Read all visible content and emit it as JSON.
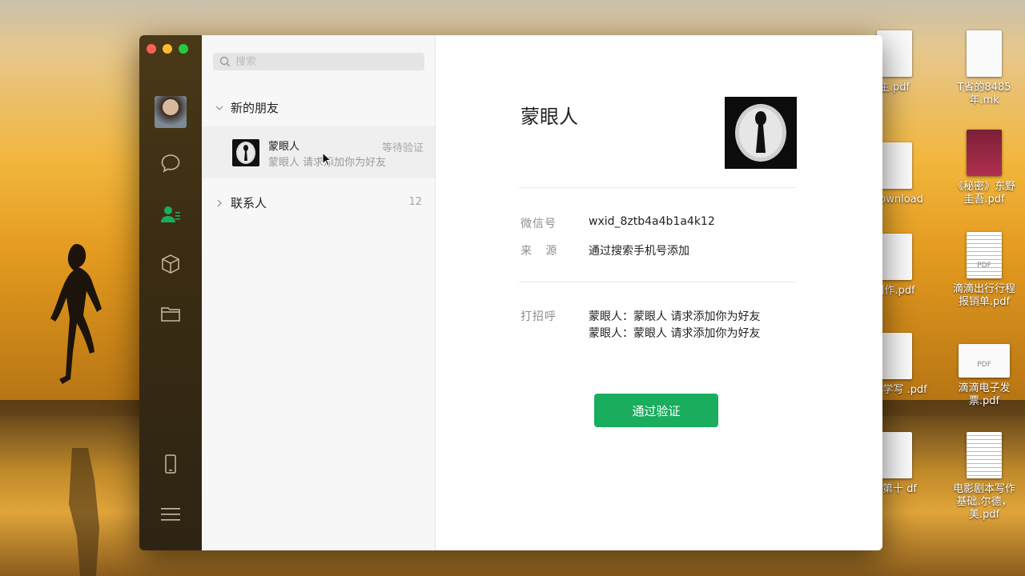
{
  "desktop": {
    "icons": [
      {
        "label": "主.pdf"
      },
      {
        "label": "T省的8485年.mk"
      },
      {
        "label": "人 ownload"
      },
      {
        "label": "《秘密》东野圭吾.pdf"
      },
      {
        "label": "创作.pdf"
      },
      {
        "label": "滴滴出行行程报销单.pdf"
      },
      {
        "label": "构文学写 .pdf"
      },
      {
        "label": "滴滴电子发票.pdf"
      },
      {
        "label": "集第十 df"
      },
      {
        "label": "电影剧本写作基础.尔德，美.pdf"
      }
    ],
    "pdf_tag": "PDF"
  },
  "sidebar": {
    "icons": [
      "chat-icon",
      "contacts-icon",
      "favorites-icon",
      "files-icon",
      "phone-icon",
      "menu-icon"
    ],
    "accent": "#1aad5e"
  },
  "list": {
    "search_placeholder": "搜索",
    "new_friends_label": "新的朋友",
    "contacts_label": "联系人",
    "contacts_count": "12",
    "request": {
      "name": "蒙眼人",
      "message": "蒙眼人  请求添加你为好友",
      "status": "等待验证"
    }
  },
  "detail": {
    "name": "蒙眼人",
    "wechat_id_label": "微信号",
    "wechat_id_value": "wxid_8ztb4a4b1a4k12",
    "source_label": "来   源",
    "source_value": "通过搜索手机号添加",
    "greeting_label": "打招呼",
    "greetings": [
      "蒙眼人：蒙眼人 请求添加你为好友",
      "蒙眼人：蒙眼人 请求添加你为好友"
    ],
    "verify_button": "通过验证"
  }
}
